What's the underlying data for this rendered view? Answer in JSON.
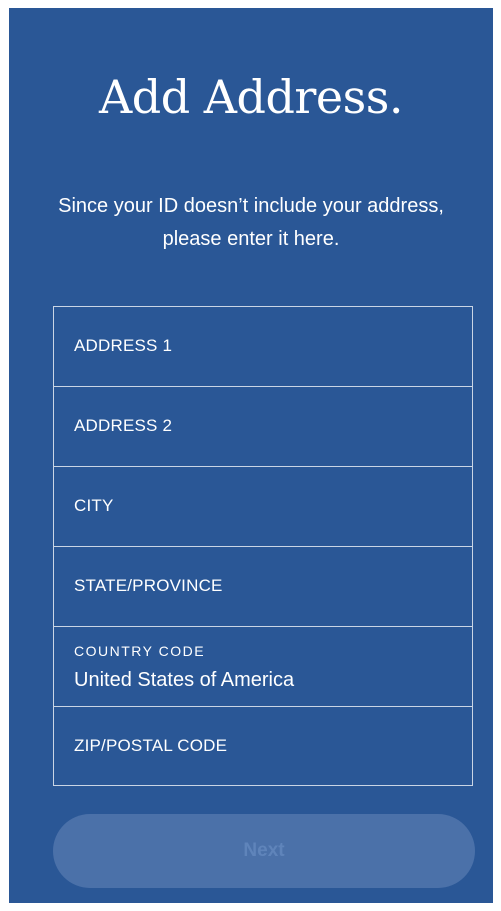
{
  "header": {
    "title": "Add Address.",
    "subtitle": "Since your ID doesn’t include your address, please enter it here."
  },
  "form": {
    "address1": {
      "placeholder": "ADDRESS 1",
      "value": ""
    },
    "address2": {
      "placeholder": "ADDRESS 2",
      "value": ""
    },
    "city": {
      "placeholder": "CITY",
      "value": ""
    },
    "state": {
      "placeholder": "STATE/PROVINCE",
      "value": ""
    },
    "country": {
      "label": "COUNTRY CODE",
      "value": "United States of America"
    },
    "zip": {
      "placeholder": "ZIP/POSTAL CODE",
      "value": ""
    }
  },
  "actions": {
    "next_label": "Next",
    "next_enabled": false
  },
  "colors": {
    "background": "#2a5796",
    "button_disabled": "#4b71a9",
    "text": "#ffffff"
  }
}
